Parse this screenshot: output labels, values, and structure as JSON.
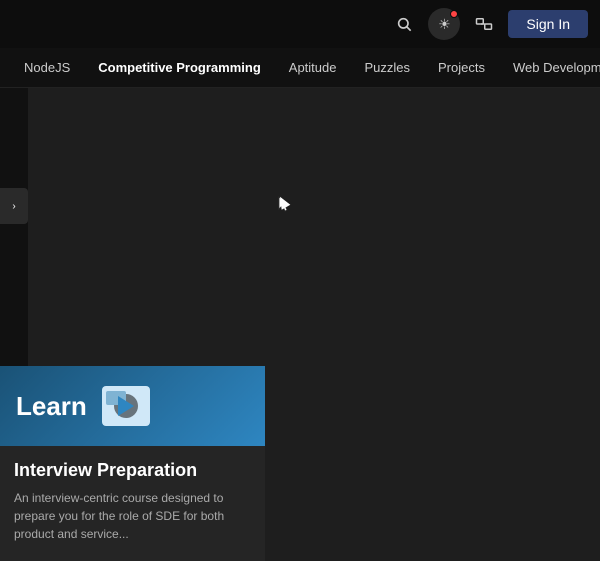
{
  "header": {
    "sign_in_label": "Sign In"
  },
  "navbar": {
    "items": [
      {
        "label": "NodeJS",
        "active": false
      },
      {
        "label": "Competitive Programming",
        "active": true
      },
      {
        "label": "Aptitude",
        "active": false
      },
      {
        "label": "Puzzles",
        "active": false
      },
      {
        "label": "Projects",
        "active": false
      },
      {
        "label": "Web Development",
        "active": false
      }
    ]
  },
  "card": {
    "learn_label": "Learn",
    "title": "Interview Preparation",
    "description": "An interview-centric course designed to prepare you for the role of SDE for both product and service..."
  }
}
